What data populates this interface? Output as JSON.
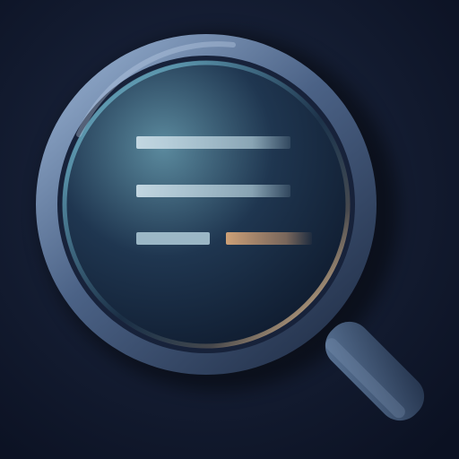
{
  "icon": {
    "name": "magnifying-glass-over-text-lines",
    "colors": {
      "background_center": "#1e2a44",
      "background_edge": "#0b1122",
      "ring_light": "#8aa3c4",
      "ring_mid": "#4b6286",
      "ring_dark": "#26354f",
      "lens_highlight": "#5b8a9e",
      "lens_deep": "#0c1628",
      "line_light": "#c9dce6",
      "line_accent": "#d6a679",
      "rim_glow": "#e7c193",
      "handle_light": "#5a7496",
      "handle_dark": "#23324b"
    },
    "lines": [
      {
        "role": "text-line-1",
        "segments": [
          {
            "color": "line_light"
          }
        ]
      },
      {
        "role": "text-line-2",
        "segments": [
          {
            "color": "line_light"
          }
        ]
      },
      {
        "role": "text-line-3",
        "segments": [
          {
            "color": "line_light"
          },
          {
            "color": "line_accent"
          }
        ]
      }
    ]
  }
}
